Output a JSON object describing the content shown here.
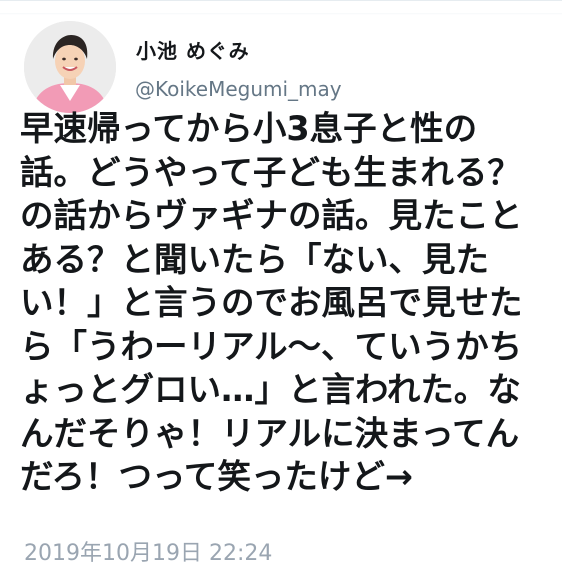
{
  "user": {
    "display_name": "小池 めぐみ",
    "handle": "@KoikeMegumi_may"
  },
  "tweet": {
    "lines": [
      "早速帰ってから小3息子と性の",
      "話。どうやって子ども生まれる？",
      "の話からヴァギナの話。見たこと",
      "ある？と聞いたら「ない、見た",
      "い！」と言うのでお風呂で見せた",
      "ら「うわーリアル〜、ていうかち",
      "ょっとグロい…」と言われた。な",
      "んだそりゃ！リアルに決まってん",
      "だろ！つって笑ったけど→"
    ],
    "timestamp": "2019年10月19日 22:24"
  }
}
